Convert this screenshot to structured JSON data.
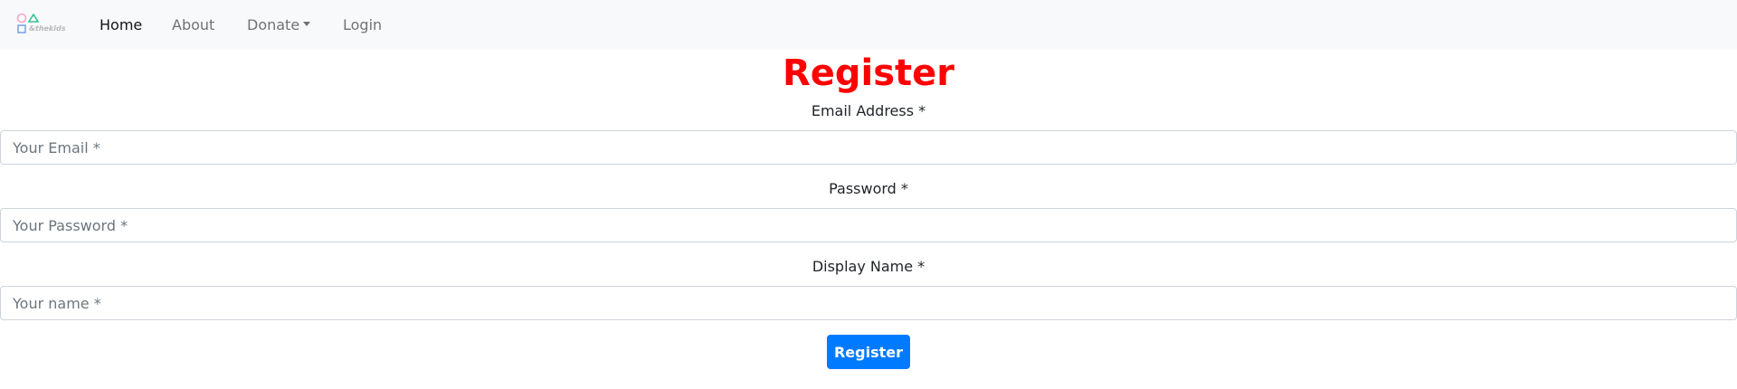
{
  "navbar": {
    "brand_text": "&thekids",
    "items": [
      {
        "label": "Home",
        "active": true
      },
      {
        "label": "About"
      },
      {
        "label": "Donate",
        "has_dropdown": true
      },
      {
        "label": "Login"
      }
    ]
  },
  "form": {
    "title": "Register",
    "fields": [
      {
        "label": "Email Address *",
        "placeholder": "Your Email *",
        "value": ""
      },
      {
        "label": "Password *",
        "placeholder": "Your Password *",
        "value": ""
      },
      {
        "label": "Display Name *",
        "placeholder": "Your name *",
        "value": ""
      }
    ],
    "submit_label": "Register"
  },
  "colors": {
    "navbar_bg": "#f8f9fa",
    "title": "#ff0000",
    "button": "#007bff",
    "logo_circle": "#f4a6c8",
    "logo_triangle": "#34c38f",
    "logo_square": "#7fa6f0"
  },
  "icons": {
    "brand_logo": "shapes-logo"
  }
}
